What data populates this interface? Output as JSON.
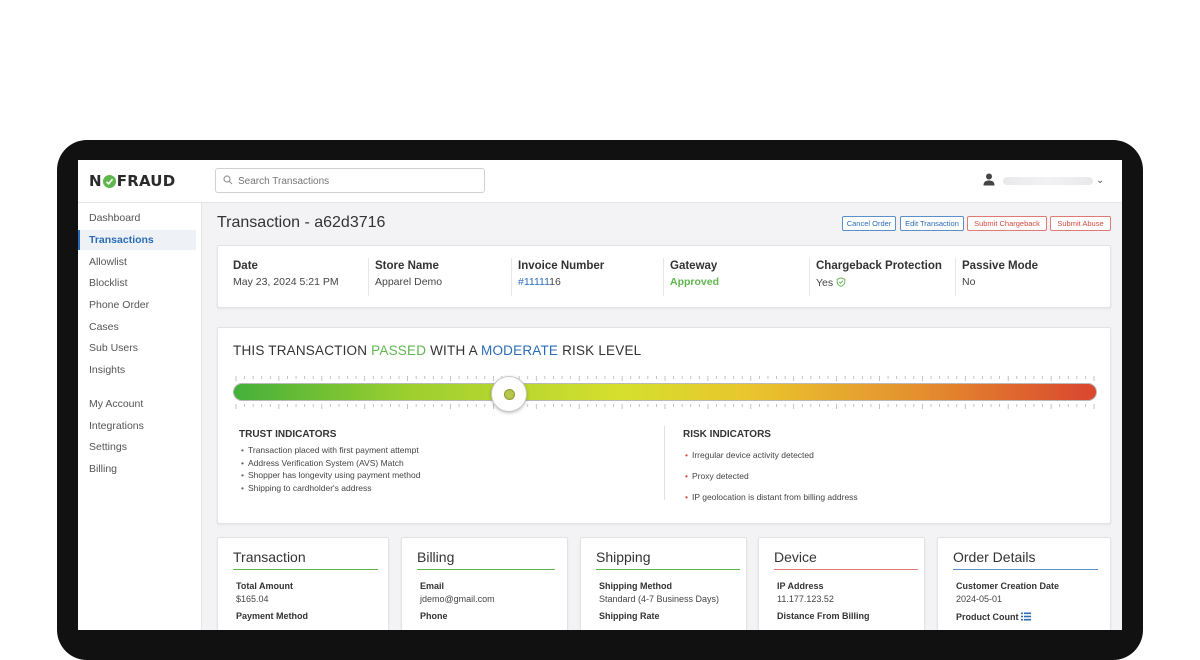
{
  "colors": {
    "accent_blue": "#2a6cb5",
    "pass_green": "#5eb64d",
    "risk_red": "#d14a42"
  },
  "header": {
    "logo_text_left": "N",
    "logo_text_right": "FRAUD",
    "search_placeholder": "Search Transactions",
    "user_icon": "user-icon"
  },
  "sidebar": {
    "items": [
      "Dashboard",
      "Transactions",
      "Allowlist",
      "Blocklist",
      "Phone Order",
      "Cases",
      "Sub Users",
      "Insights"
    ],
    "items2": [
      "My Account",
      "Integrations",
      "Settings",
      "Billing"
    ],
    "active": "Transactions"
  },
  "page": {
    "title": "Transaction - a62d3716",
    "actions": [
      "Cancel Order",
      "Edit Transaction",
      "Submit Chargeback",
      "Submit Abuse"
    ]
  },
  "summary": {
    "date_label": "Date",
    "date_value": "May 23, 2024 5:21 PM",
    "store_label": "Store Name",
    "store_value": "Apparel Demo",
    "invoice_label": "Invoice Number",
    "invoice_link": "#11111",
    "invoice_rest": "16",
    "gateway_label": "Gateway",
    "gateway_value": "Approved",
    "chargeback_label": "Chargeback Protection",
    "chargeback_value": "Yes",
    "passive_label": "Passive Mode",
    "passive_value": "No"
  },
  "risk": {
    "title_pre": "THIS TRANSACTION ",
    "title_passed": "PASSED",
    "title_mid": " WITH A ",
    "title_level": "MODERATE",
    "title_post": " RISK LEVEL",
    "meter_position": 0.32,
    "trust_heading": "TRUST INDICATORS",
    "trust_items": [
      "Transaction placed with first payment attempt",
      "Address Verification System (AVS) Match",
      "Shopper has longevity using payment method",
      "Shipping to cardholder's address"
    ],
    "risk_heading": "RISK INDICATORS",
    "risk_items": [
      "Irregular device activity detected",
      "Proxy detected",
      "IP geolocation is distant from billing address"
    ]
  },
  "detail_cards": [
    {
      "title": "Transaction",
      "rule_color": "#5eb64d",
      "label1": "Total Amount",
      "value1": "$165.04",
      "label2": "Payment Method"
    },
    {
      "title": "Billing",
      "rule_color": "#5eb64d",
      "label1": "Email",
      "value1": "jdemo@gmail.com",
      "label2": "Phone"
    },
    {
      "title": "Shipping",
      "rule_color": "#5eb64d",
      "label1": "Shipping Method",
      "value1": "Standard (4-7 Business Days)",
      "label2": "Shipping Rate"
    },
    {
      "title": "Device",
      "rule_color": "#e07a74",
      "label1": "IP Address",
      "value1": "11.177.123.52",
      "label2": "Distance From Billing"
    },
    {
      "title": "Order Details",
      "rule_color": "#5b8fc8",
      "label1": "Customer Creation Date",
      "value1": "2024-05-01",
      "label2": "Product Count"
    }
  ]
}
